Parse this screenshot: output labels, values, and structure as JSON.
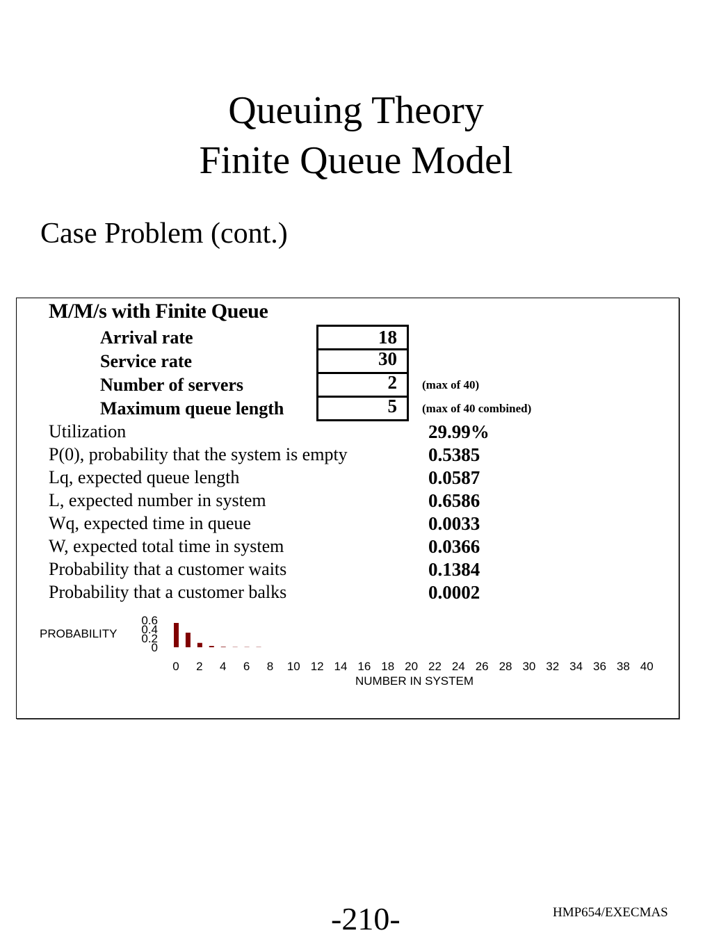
{
  "slide": {
    "title_line1": "Queuing Theory",
    "title_line2": "Finite Queue Model",
    "subtitle": "Case Problem (cont.)",
    "page_number": "-210-",
    "course_code": "HMP654/EXECMAS"
  },
  "sheet": {
    "title": "M/M/s with Finite Queue",
    "inputs": [
      {
        "label": "Arrival rate",
        "value": "18",
        "note": ""
      },
      {
        "label": "Service rate",
        "value": "30",
        "note": ""
      },
      {
        "label": "Number of servers",
        "value": "2",
        "note": "(max of 40)"
      },
      {
        "label": "Maximum queue length",
        "value": "5",
        "note": "(max of 40 combined)"
      }
    ],
    "outputs": [
      {
        "label": "Utilization",
        "value": "29.99%"
      },
      {
        "label": "P(0), probability that the system is empty",
        "value": "0.5385"
      },
      {
        "label": "Lq, expected queue length",
        "value": "0.0587"
      },
      {
        "label": "L, expected number in system",
        "value": "0.6586"
      },
      {
        "label": "Wq, expected time in queue",
        "value": "0.0033"
      },
      {
        "label": "W, expected total time in system",
        "value": "0.0366"
      },
      {
        "label": "Probability that a customer waits",
        "value": "0.1384"
      },
      {
        "label": "Probability that a customer balks",
        "value": "0.0002"
      }
    ]
  },
  "chart_data": {
    "type": "bar",
    "title": "",
    "xlabel": "NUMBER IN SYSTEM",
    "ylabel": "PROBABILITY",
    "ylim": [
      0,
      0.6
    ],
    "yticks": [
      "0.6",
      "0.4",
      "0.2",
      "0"
    ],
    "xticks": [
      "0",
      "2",
      "4",
      "6",
      "8",
      "10",
      "12",
      "14",
      "16",
      "18",
      "20",
      "22",
      "24",
      "26",
      "28",
      "30",
      "32",
      "34",
      "36",
      "38",
      "40"
    ],
    "x": [
      0,
      1,
      2,
      3,
      4,
      5,
      6,
      7
    ],
    "values": [
      0.5385,
      0.3231,
      0.0969,
      0.0291,
      0.0087,
      0.0026,
      0.0008,
      0.0002
    ],
    "bar_color": "#800000",
    "grid": false,
    "legend": "none"
  }
}
